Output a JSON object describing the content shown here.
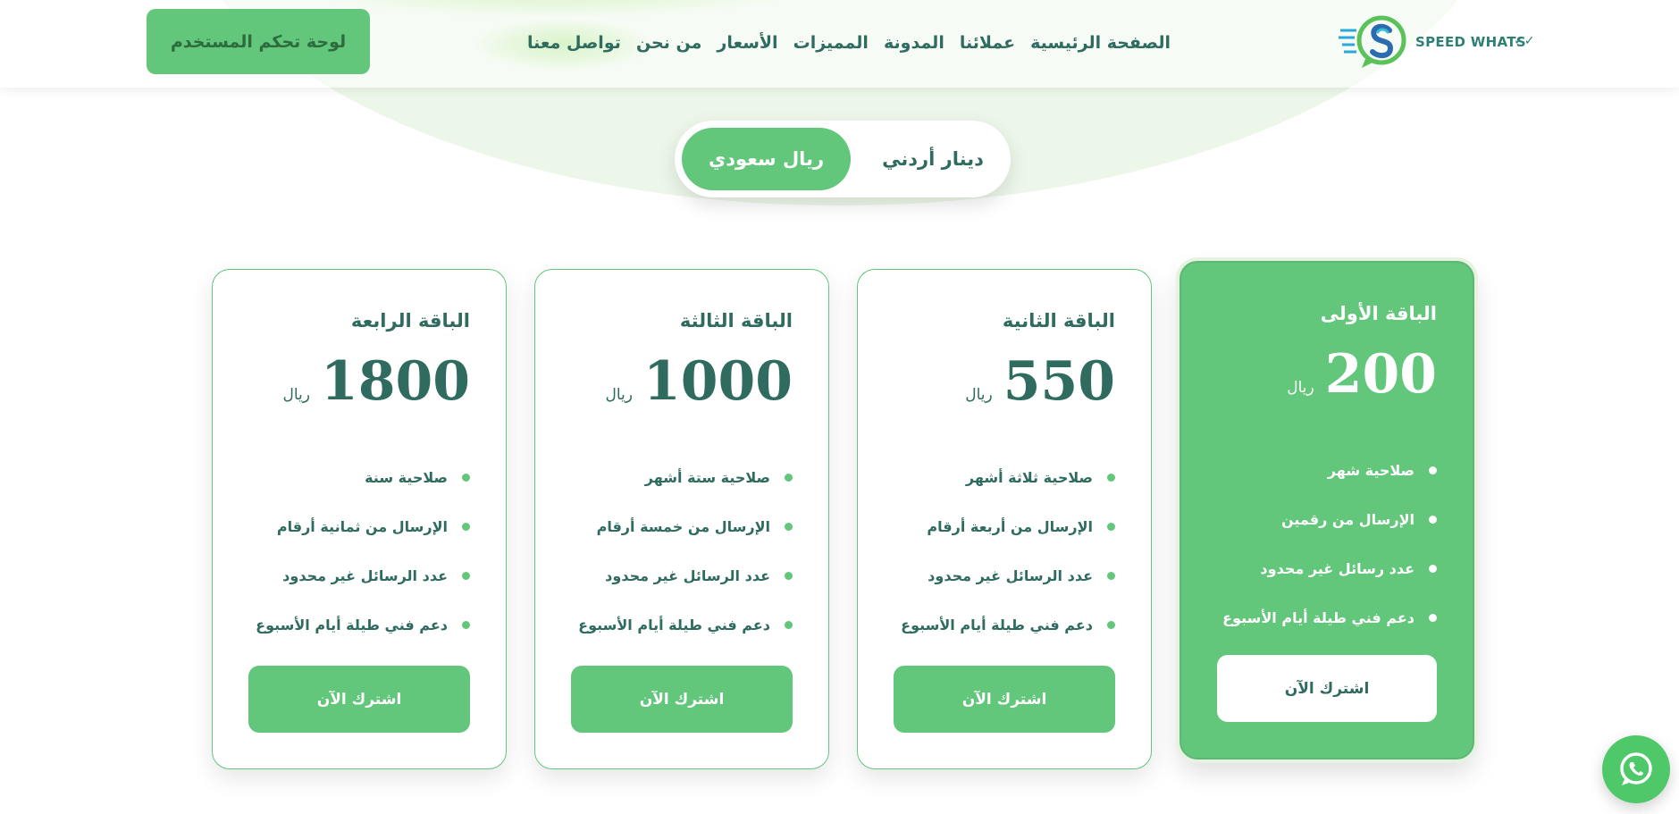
{
  "brand": {
    "name": "SPEED WHATS",
    "accent": "#62c67b",
    "text_color": "#2f6b5f"
  },
  "header": {
    "dashboard_label": "لوحة تحكم المستخدم",
    "nav": [
      "الصفحة الرئيسية",
      "عملائنا",
      "المدونة",
      "المميزات",
      "الأسعار",
      "من نحن",
      "تواصل معنا"
    ]
  },
  "currency": {
    "options": [
      "ريال سعودي",
      "دينار أردني"
    ],
    "selected": "ريال سعودي"
  },
  "plans": [
    {
      "title": "الباقة الأولى",
      "price": "200",
      "currency": "ريال",
      "features": [
        "صلاحية شهر",
        "الإرسال من رقمين",
        "عدد رسائل غير محدود",
        "دعم فني طيلة أيام الأسبوع"
      ],
      "cta": "اشترك الآن",
      "featured": true
    },
    {
      "title": "الباقة الثانية",
      "price": "550",
      "currency": "ريال",
      "features": [
        "صلاحية ثلاثة أشهر",
        "الإرسال من أربعة أرقام",
        "عدد الرسائل غير محدود",
        "دعم فني طيلة أيام الأسبوع"
      ],
      "cta": "اشترك الآن",
      "featured": false
    },
    {
      "title": "الباقة الثالثة",
      "price": "1000",
      "currency": "ريال",
      "features": [
        "صلاحية ستة أشهر",
        "الإرسال من خمسة أرقام",
        "عدد الرسائل غير محدود",
        "دعم فني طيلة أيام الأسبوع"
      ],
      "cta": "اشترك الآن",
      "featured": false
    },
    {
      "title": "الباقة الرابعة",
      "price": "1800",
      "currency": "ريال",
      "features": [
        "صلاحية سنة",
        "الإرسال من ثمانية أرقام",
        "عدد الرسائل غير محدود",
        "دعم فني طيلة أيام الأسبوع"
      ],
      "cta": "اشترك الآن",
      "featured": false
    }
  ],
  "icons": {
    "logo": "speed-whats-logo-icon",
    "whatsapp": "whatsapp-icon"
  }
}
